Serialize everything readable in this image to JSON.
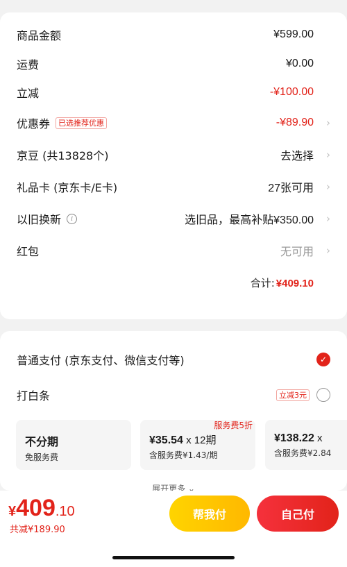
{
  "summary": {
    "rows": [
      {
        "label": "商品金额",
        "value": "¥599.00"
      },
      {
        "label": "运费",
        "value": "¥0.00"
      },
      {
        "label": "立减",
        "value": "-¥100.00"
      },
      {
        "label": "优惠券",
        "tag": "已选推荐优惠",
        "value": "-¥89.90"
      },
      {
        "label": "京豆 (共13828个)",
        "value": "去选择"
      },
      {
        "label": "礼品卡 (京东卡/E卡)",
        "value": "27张可用"
      },
      {
        "label": "以旧换新",
        "value": "选旧品，最高补贴¥350.00"
      },
      {
        "label": "红包",
        "value": "无可用"
      }
    ],
    "total_label": "合计:",
    "total_value": "¥409.10"
  },
  "payment": {
    "normal_label": "普通支付 (京东支付、微信支付等)",
    "baitiao_label": "打白条",
    "baitiao_promo": "立减3元",
    "plans": [
      {
        "amount": "不分期",
        "unit": "",
        "sub": "免服务费",
        "badge": ""
      },
      {
        "amount": "¥35.54",
        "unit": " x 12期",
        "sub": "含服务费¥1.43/期",
        "badge": "服务费5折"
      },
      {
        "amount": "¥138.22",
        "unit": " x",
        "sub": "含服务费¥2.84",
        "badge": ""
      }
    ],
    "expand_label": "展开更多 ⌄"
  },
  "footer": {
    "currency": "¥",
    "price_int": "409",
    "price_dec": ".10",
    "saved": "共减¥189.90",
    "help_pay": "帮我付",
    "self_pay": "自己付"
  },
  "colors": {
    "accent": "#e2231a",
    "yellow": "#ffc700"
  }
}
